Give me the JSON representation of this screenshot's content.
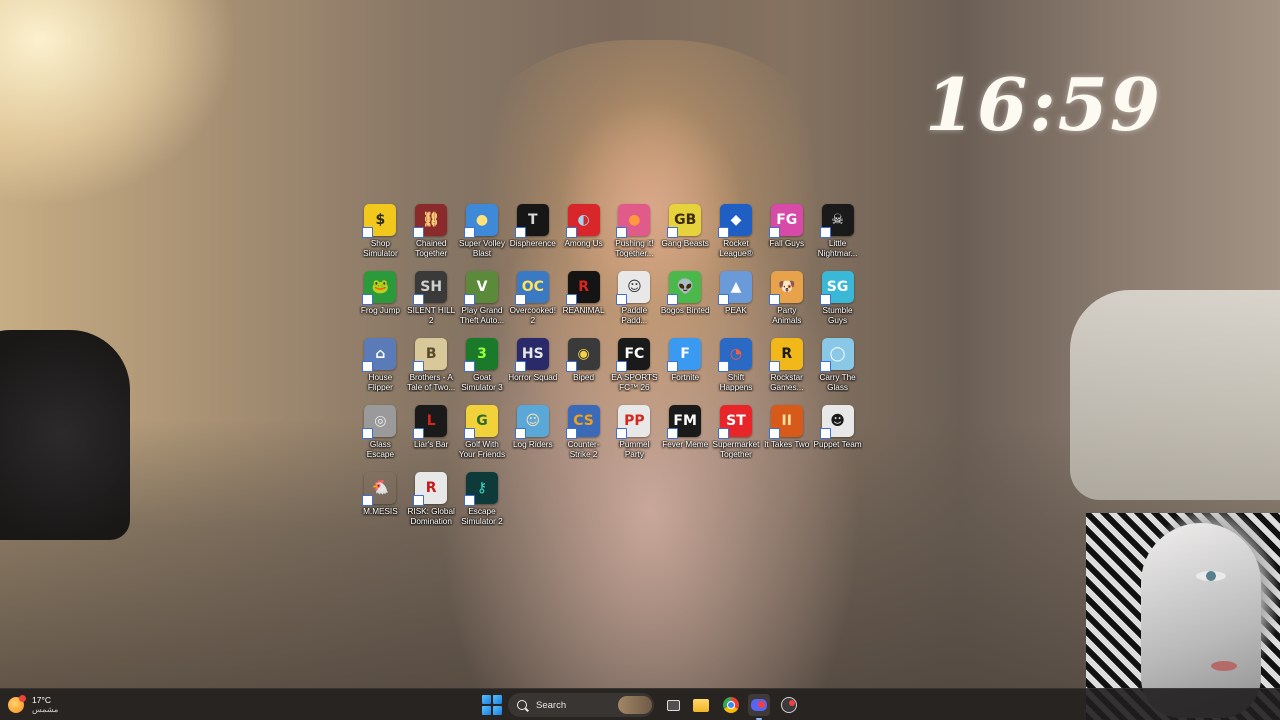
{
  "desktop": {
    "clock": "16:59",
    "icons": [
      {
        "label": "Shop Simulator",
        "icon": "dollar-icon",
        "glyph": "$",
        "color": "#f2c81c",
        "fg": "#2a2a2a"
      },
      {
        "label": "Chained Together",
        "icon": "chain-icon",
        "glyph": "⛓",
        "color": "#8a2a2a",
        "fg": "#ffd27a"
      },
      {
        "label": "Super Volley Blast",
        "icon": "volleyball-icon",
        "glyph": "●",
        "color": "#3f8ad8",
        "fg": "#ffe27a"
      },
      {
        "label": "Dispherence",
        "icon": "tilis-icon",
        "glyph": "T",
        "color": "#161616",
        "fg": "#d8d8d8"
      },
      {
        "label": "Among Us",
        "icon": "crewmate-icon",
        "glyph": "◐",
        "color": "#d8262a",
        "fg": "#9fd8f0"
      },
      {
        "label": "Pushing it! Together...",
        "icon": "ball-icon",
        "glyph": "●",
        "color": "#e05a8a",
        "fg": "#ff9a3c"
      },
      {
        "label": "Gang Beasts",
        "icon": "gang-beasts-icon",
        "glyph": "GB",
        "color": "#e6d23a",
        "fg": "#3a2a10"
      },
      {
        "label": "Rocket League®",
        "icon": "rocket-league-icon",
        "glyph": "◆",
        "color": "#1f5fc4",
        "fg": "#ffffff"
      },
      {
        "label": "Fall Guys",
        "icon": "fall-guys-icon",
        "glyph": "FG",
        "color": "#d84aa8",
        "fg": "#ffffff"
      },
      {
        "label": "Little Nightmar...",
        "icon": "little-nightmares-icon",
        "glyph": "☠",
        "color": "#1a1a1a",
        "fg": "#ffffff"
      },
      {
        "label": "Frog Jump",
        "icon": "frog-icon",
        "glyph": "🐸",
        "color": "#2a9a3a",
        "fg": "#ffffff"
      },
      {
        "label": "SILENT HILL 2",
        "icon": "silent-hill-icon",
        "glyph": "SH",
        "color": "#3a3a3a",
        "fg": "#d0d0d0"
      },
      {
        "label": "Play Grand Theft Auto...",
        "icon": "gta-icon",
        "glyph": "V",
        "color": "#5a8a3a",
        "fg": "#ffffff"
      },
      {
        "label": "Overcooked! 2",
        "icon": "overcooked-icon",
        "glyph": "OC",
        "color": "#3a7ac4",
        "fg": "#ffe25a"
      },
      {
        "label": "REANIMAL",
        "icon": "reanimal-icon",
        "glyph": "R",
        "color": "#141414",
        "fg": "#d8261a"
      },
      {
        "label": "Paddle Padd...",
        "icon": "paddle-icon",
        "glyph": "☺",
        "color": "#e8e8e8",
        "fg": "#333333"
      },
      {
        "label": "Bogos Binted",
        "icon": "alien-icon",
        "glyph": "👽",
        "color": "#4ab84a",
        "fg": "#ffffff"
      },
      {
        "label": "PEAK",
        "icon": "peak-icon",
        "glyph": "▲",
        "color": "#6a9ad8",
        "fg": "#ffffff"
      },
      {
        "label": "Party Animals",
        "icon": "dog-icon",
        "glyph": "🐶",
        "color": "#e8a24a",
        "fg": "#ffffff"
      },
      {
        "label": "Stumble Guys",
        "icon": "stumble-guys-icon",
        "glyph": "SG",
        "color": "#3ab8d8",
        "fg": "#ffffff"
      },
      {
        "label": "House Flipper",
        "icon": "house-icon",
        "glyph": "⌂",
        "color": "#5a7ab8",
        "fg": "#ffffff"
      },
      {
        "label": "Brothers - A Tale of Two...",
        "icon": "brothers-icon",
        "glyph": "B",
        "color": "#d8c89a",
        "fg": "#5a4a2a"
      },
      {
        "label": "Goat Simulator 3",
        "icon": "goat-icon",
        "glyph": "3",
        "color": "#1a7a2a",
        "fg": "#9aff3a"
      },
      {
        "label": "Horror Squad",
        "icon": "horror-squad-icon",
        "glyph": "HS",
        "color": "#2a2a6a",
        "fg": "#e8e8e8"
      },
      {
        "label": "Biped",
        "icon": "biped-icon",
        "glyph": "◉",
        "color": "#3a3a3a",
        "fg": "#f2d24a"
      },
      {
        "label": "EA SPORTS FC™ 26",
        "icon": "ea-fc-icon",
        "glyph": "FC",
        "color": "#1a1a1a",
        "fg": "#ffffff"
      },
      {
        "label": "Fortnite",
        "icon": "fortnite-icon",
        "glyph": "F",
        "color": "#3a9af2",
        "fg": "#ffffff"
      },
      {
        "label": "Shift Happens",
        "icon": "shift-happens-icon",
        "glyph": "◔",
        "color": "#2a6ac4",
        "fg": "#ff5a3a"
      },
      {
        "label": "Rockstar Games...",
        "icon": "rockstar-icon",
        "glyph": "R",
        "color": "#f2b81a",
        "fg": "#1a1a1a"
      },
      {
        "label": "Carry The Glass",
        "icon": "carry-glass-icon",
        "glyph": "◯",
        "color": "#8ac8e8",
        "fg": "#ffffff"
      },
      {
        "label": "Glass Escape",
        "icon": "glass-escape-icon",
        "glyph": "◎",
        "color": "#9a9a9a",
        "fg": "#eaeaea"
      },
      {
        "label": "Liar's Bar",
        "icon": "liars-bar-icon",
        "glyph": "L",
        "color": "#1a1a1a",
        "fg": "#d8261a"
      },
      {
        "label": "Golf With Your Friends",
        "icon": "golf-icon",
        "glyph": "G",
        "color": "#f2d23a",
        "fg": "#2a6a2a"
      },
      {
        "label": "Log Riders",
        "icon": "log-riders-icon",
        "glyph": "☺",
        "color": "#5aa8d8",
        "fg": "#ffe0b0"
      },
      {
        "label": "Counter-Strike 2",
        "icon": "counter-strike-icon",
        "glyph": "CS",
        "color": "#3a6ab8",
        "fg": "#f2a21a"
      },
      {
        "label": "Pummel Party",
        "icon": "pummel-party-icon",
        "glyph": "PP",
        "color": "#e8e8e8",
        "fg": "#d8261a"
      },
      {
        "label": "Fever Meme",
        "icon": "fever-meme-icon",
        "glyph": "FM",
        "color": "#1a1a1a",
        "fg": "#ffffff"
      },
      {
        "label": "Supermarket Together",
        "icon": "supermarket-icon",
        "glyph": "ST",
        "color": "#e8262a",
        "fg": "#ffffff"
      },
      {
        "label": "It Takes Two",
        "icon": "it-takes-two-icon",
        "glyph": "II",
        "color": "#d85a1a",
        "fg": "#ffe0a0"
      },
      {
        "label": "Puppet Team",
        "icon": "puppet-icon",
        "glyph": "☻",
        "color": "#e8e8e8",
        "fg": "#1a1a1a"
      },
      {
        "label": "M.MESIS",
        "icon": "chicken-icon",
        "glyph": "🐔",
        "color": "rgba(0,0,0,0)",
        "fg": "#d8261a"
      },
      {
        "label": "RISK: Global Domination",
        "icon": "risk-icon",
        "glyph": "R",
        "color": "#e8e8e8",
        "fg": "#c81a1a"
      },
      {
        "label": "Escape Simulator 2",
        "icon": "keyhole-icon",
        "glyph": "⚷",
        "color": "#0f3a3a",
        "fg": "#3ad8c8"
      }
    ]
  },
  "taskbar": {
    "weather_temp": "17°C",
    "weather_condition": "مشمس",
    "search_label": "Search"
  }
}
